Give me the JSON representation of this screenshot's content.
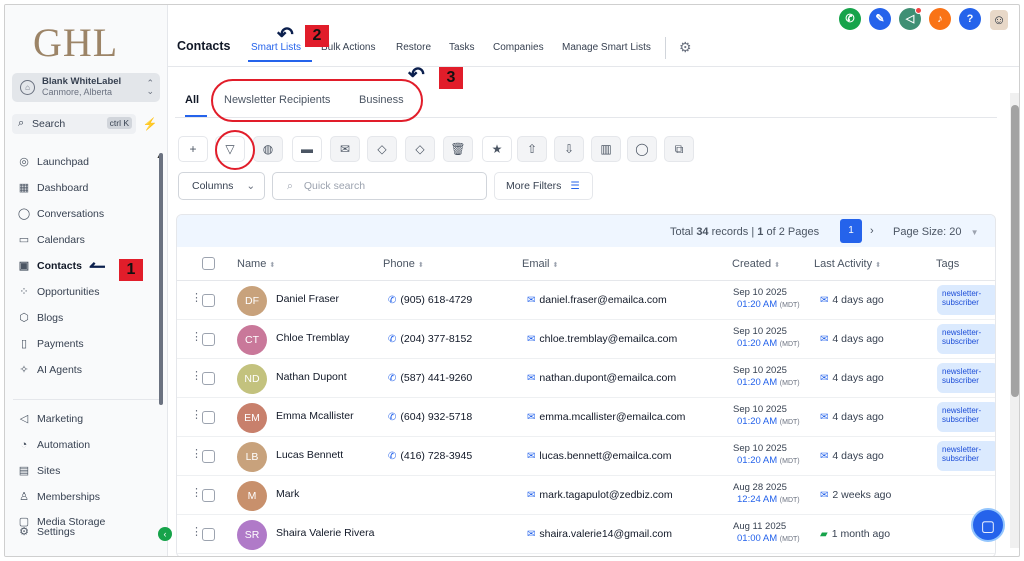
{
  "sidebar": {
    "logo": "GHL",
    "account_name": "Blank WhiteLabel",
    "account_location": "Canmore, Alberta",
    "search_label": "Search",
    "search_shortcut": "ctrl K",
    "nav": [
      {
        "label": "Launchpad",
        "icon": "rocket-icon",
        "glyph": "◎"
      },
      {
        "label": "Dashboard",
        "icon": "grid-icon",
        "glyph": "▦"
      },
      {
        "label": "Conversations",
        "icon": "chat-icon",
        "glyph": "◯"
      },
      {
        "label": "Calendars",
        "icon": "calendar-icon",
        "glyph": "▭"
      },
      {
        "label": "Contacts",
        "icon": "contacts-icon",
        "glyph": "▣"
      },
      {
        "label": "Opportunities",
        "icon": "opportunities-icon",
        "glyph": "⁘"
      },
      {
        "label": "Blogs",
        "icon": "blog-icon",
        "glyph": "⬡"
      },
      {
        "label": "Payments",
        "icon": "payments-icon",
        "glyph": "▯"
      },
      {
        "label": "AI Agents",
        "icon": "sparkle-icon",
        "glyph": "✧"
      },
      {
        "label": "Marketing",
        "icon": "megaphone-icon",
        "glyph": "◁"
      },
      {
        "label": "Automation",
        "icon": "automation-icon",
        "glyph": "◔"
      },
      {
        "label": "Sites",
        "icon": "sites-icon",
        "glyph": "▤"
      },
      {
        "label": "Memberships",
        "icon": "membership-icon",
        "glyph": "♙"
      },
      {
        "label": "Media Storage",
        "icon": "media-icon",
        "glyph": "▢"
      },
      {
        "label": "Settings",
        "icon": "settings-icon",
        "glyph": "⚙"
      }
    ]
  },
  "header": {
    "title": "Contacts",
    "tabs": [
      "Smart Lists",
      "Bulk Actions",
      "Restore",
      "Tasks",
      "Companies",
      "Manage Smart Lists"
    ],
    "active_tab": "Smart Lists"
  },
  "smart_lists": {
    "tabs": [
      "All",
      "Newsletter Recipients",
      "Business"
    ],
    "active": "All"
  },
  "toolbar": {
    "columns_label": "Columns",
    "quick_search_placeholder": "Quick search",
    "more_filters_label": "More Filters"
  },
  "table": {
    "total_prefix": "Total",
    "total_records": "34",
    "records_suffix": "records |",
    "current_page": "1",
    "pages_text": "of 2 Pages",
    "page_button": "1",
    "page_size_label": "Page Size: 20",
    "columns": [
      "Name",
      "Phone",
      "Email",
      "Created",
      "Last Activity",
      "Tags"
    ],
    "rows": [
      {
        "initials": "DF",
        "color": "#c8a27c",
        "name": "Daniel Fraser",
        "phone": "(905) 618-4729",
        "email": "daniel.fraser@emailca.com",
        "date": "Sep 10 2025",
        "time": "01:20 AM",
        "tz": "(MDT)",
        "activity": "4 days ago",
        "tag": "newsletter-subscriber"
      },
      {
        "initials": "CT",
        "color": "#c9789a",
        "name": "Chloe Tremblay",
        "phone": "(204) 377-8152",
        "email": "chloe.tremblay@emailca.com",
        "date": "Sep 10 2025",
        "time": "01:20 AM",
        "tz": "(MDT)",
        "activity": "4 days ago",
        "tag": "newsletter-subscriber"
      },
      {
        "initials": "ND",
        "color": "#c3c27e",
        "name": "Nathan Dupont",
        "phone": "(587) 441-9260",
        "email": "nathan.dupont@emailca.com",
        "date": "Sep 10 2025",
        "time": "01:20 AM",
        "tz": "(MDT)",
        "activity": "4 days ago",
        "tag": "newsletter-subscriber"
      },
      {
        "initials": "EM",
        "color": "#c8806c",
        "name": "Emma Mcallister",
        "phone": "(604) 932-5718",
        "email": "emma.mcallister@emailca.com",
        "date": "Sep 10 2025",
        "time": "01:20 AM",
        "tz": "(MDT)",
        "activity": "4 days ago",
        "tag": "newsletter-subscriber"
      },
      {
        "initials": "LB",
        "color": "#c8a27c",
        "name": "Lucas Bennett",
        "phone": "(416) 728-3945",
        "email": "lucas.bennett@emailca.com",
        "date": "Sep 10 2025",
        "time": "01:20 AM",
        "tz": "(MDT)",
        "activity": "4 days ago",
        "tag": "newsletter-subscriber"
      },
      {
        "initials": "M",
        "color": "#c8906c",
        "name": "Mark",
        "phone": "",
        "email": "mark.tagapulot@zedbiz.com",
        "date": "Aug 28 2025",
        "time": "12:24 AM",
        "tz": "(MDT)",
        "activity": "2 weeks ago",
        "tag": ""
      },
      {
        "initials": "SR",
        "color": "#b07ac8",
        "name": "Shaira Valerie Rivera",
        "phone": "",
        "email": "shaira.valerie14@gmail.com",
        "date": "Aug 11 2025",
        "time": "01:00 AM",
        "tz": "(MDT)",
        "activity": "1 month ago",
        "tag": ""
      }
    ]
  },
  "annotations": [
    "1",
    "2",
    "3"
  ],
  "colors": {
    "accent": "#2563eb",
    "annotation": "#e11d2a"
  }
}
